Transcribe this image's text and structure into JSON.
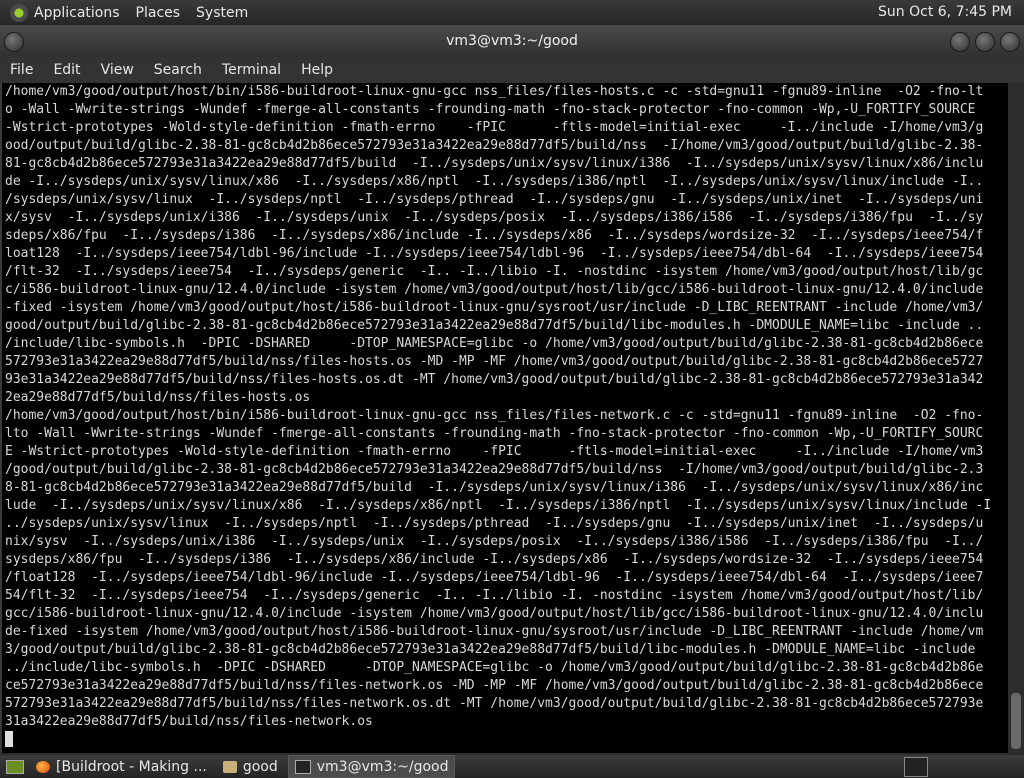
{
  "panel": {
    "menus": [
      "Applications",
      "Places",
      "System"
    ],
    "clock": "Sun Oct  6,  7:45 PM"
  },
  "window": {
    "title": "vm3@vm3:~/good"
  },
  "menubar": [
    "File",
    "Edit",
    "View",
    "Search",
    "Terminal",
    "Help"
  ],
  "terminal": {
    "lines": [
      "/home/vm3/good/output/host/bin/i586-buildroot-linux-gnu-gcc nss_files/files-hosts.c -c -std=gnu11 -fgnu89-inline  -O2 -fno-lt",
      "o -Wall -Wwrite-strings -Wundef -fmerge-all-constants -frounding-math -fno-stack-protector -fno-common -Wp,-U_FORTIFY_SOURCE",
      "-Wstrict-prototypes -Wold-style-definition -fmath-errno    -fPIC      -ftls-model=initial-exec     -I../include -I/home/vm3/g",
      "ood/output/build/glibc-2.38-81-gc8cb4d2b86ece572793e31a3422ea29e88d77df5/build/nss  -I/home/vm3/good/output/build/glibc-2.38-",
      "81-gc8cb4d2b86ece572793e31a3422ea29e88d77df5/build  -I../sysdeps/unix/sysv/linux/i386  -I../sysdeps/unix/sysv/linux/x86/inclu",
      "de -I../sysdeps/unix/sysv/linux/x86  -I../sysdeps/x86/nptl  -I../sysdeps/i386/nptl  -I../sysdeps/unix/sysv/linux/include -I..",
      "/sysdeps/unix/sysv/linux  -I../sysdeps/nptl  -I../sysdeps/pthread  -I../sysdeps/gnu  -I../sysdeps/unix/inet  -I../sysdeps/uni",
      "x/sysv  -I../sysdeps/unix/i386  -I../sysdeps/unix  -I../sysdeps/posix  -I../sysdeps/i386/i586  -I../sysdeps/i386/fpu  -I../sy",
      "sdeps/x86/fpu  -I../sysdeps/i386  -I../sysdeps/x86/include -I../sysdeps/x86  -I../sysdeps/wordsize-32  -I../sysdeps/ieee754/f",
      "loat128  -I../sysdeps/ieee754/ldbl-96/include -I../sysdeps/ieee754/ldbl-96  -I../sysdeps/ieee754/dbl-64  -I../sysdeps/ieee754",
      "/flt-32  -I../sysdeps/ieee754  -I../sysdeps/generic  -I.. -I../libio -I. -nostdinc -isystem /home/vm3/good/output/host/lib/gc",
      "c/i586-buildroot-linux-gnu/12.4.0/include -isystem /home/vm3/good/output/host/lib/gcc/i586-buildroot-linux-gnu/12.4.0/include",
      "-fixed -isystem /home/vm3/good/output/host/i586-buildroot-linux-gnu/sysroot/usr/include -D_LIBC_REENTRANT -include /home/vm3/",
      "good/output/build/glibc-2.38-81-gc8cb4d2b86ece572793e31a3422ea29e88d77df5/build/libc-modules.h -DMODULE_NAME=libc -include ..",
      "/include/libc-symbols.h  -DPIC -DSHARED     -DTOP_NAMESPACE=glibc -o /home/vm3/good/output/build/glibc-2.38-81-gc8cb4d2b86ece",
      "572793e31a3422ea29e88d77df5/build/nss/files-hosts.os -MD -MP -MF /home/vm3/good/output/build/glibc-2.38-81-gc8cb4d2b86ece5727",
      "93e31a3422ea29e88d77df5/build/nss/files-hosts.os.dt -MT /home/vm3/good/output/build/glibc-2.38-81-gc8cb4d2b86ece572793e31a342",
      "2ea29e88d77df5/build/nss/files-hosts.os",
      "/home/vm3/good/output/host/bin/i586-buildroot-linux-gnu-gcc nss_files/files-network.c -c -std=gnu11 -fgnu89-inline  -O2 -fno-",
      "lto -Wall -Wwrite-strings -Wundef -fmerge-all-constants -frounding-math -fno-stack-protector -fno-common -Wp,-U_FORTIFY_SOURC",
      "E -Wstrict-prototypes -Wold-style-definition -fmath-errno    -fPIC      -ftls-model=initial-exec     -I../include -I/home/vm3",
      "/good/output/build/glibc-2.38-81-gc8cb4d2b86ece572793e31a3422ea29e88d77df5/build/nss  -I/home/vm3/good/output/build/glibc-2.3",
      "8-81-gc8cb4d2b86ece572793e31a3422ea29e88d77df5/build  -I../sysdeps/unix/sysv/linux/i386  -I../sysdeps/unix/sysv/linux/x86/inc",
      "lude  -I../sysdeps/unix/sysv/linux/x86  -I../sysdeps/x86/nptl  -I../sysdeps/i386/nptl  -I../sysdeps/unix/sysv/linux/include -I",
      "../sysdeps/unix/sysv/linux  -I../sysdeps/nptl  -I../sysdeps/pthread  -I../sysdeps/gnu  -I../sysdeps/unix/inet  -I../sysdeps/u",
      "nix/sysv  -I../sysdeps/unix/i386  -I../sysdeps/unix  -I../sysdeps/posix  -I../sysdeps/i386/i586  -I../sysdeps/i386/fpu  -I../",
      "sysdeps/x86/fpu  -I../sysdeps/i386  -I../sysdeps/x86/include -I../sysdeps/x86  -I../sysdeps/wordsize-32  -I../sysdeps/ieee754",
      "/float128  -I../sysdeps/ieee754/ldbl-96/include -I../sysdeps/ieee754/ldbl-96  -I../sysdeps/ieee754/dbl-64  -I../sysdeps/ieee7",
      "54/flt-32  -I../sysdeps/ieee754  -I../sysdeps/generic  -I.. -I../libio -I. -nostdinc -isystem /home/vm3/good/output/host/lib/",
      "gcc/i586-buildroot-linux-gnu/12.4.0/include -isystem /home/vm3/good/output/host/lib/gcc/i586-buildroot-linux-gnu/12.4.0/inclu",
      "de-fixed -isystem /home/vm3/good/output/host/i586-buildroot-linux-gnu/sysroot/usr/include -D_LIBC_REENTRANT -include /home/vm",
      "3/good/output/build/glibc-2.38-81-gc8cb4d2b86ece572793e31a3422ea29e88d77df5/build/libc-modules.h -DMODULE_NAME=libc -include",
      "../include/libc-symbols.h  -DPIC -DSHARED     -DTOP_NAMESPACE=glibc -o /home/vm3/good/output/build/glibc-2.38-81-gc8cb4d2b86e",
      "ce572793e31a3422ea29e88d77df5/build/nss/files-network.os -MD -MP -MF /home/vm3/good/output/build/glibc-2.38-81-gc8cb4d2b86ece",
      "572793e31a3422ea29e88d77df5/build/nss/files-network.os.dt -MT /home/vm3/good/output/build/glibc-2.38-81-gc8cb4d2b86ece572793e",
      "31a3422ea29e88d77df5/build/nss/files-network.os"
    ]
  },
  "taskbar": {
    "tasks": [
      {
        "label": "[Buildroot - Making ...",
        "icon": "firefox-icon"
      },
      {
        "label": "good",
        "icon": "folder-icon"
      },
      {
        "label": "vm3@vm3:~/good",
        "icon": "terminal-icon"
      }
    ]
  }
}
